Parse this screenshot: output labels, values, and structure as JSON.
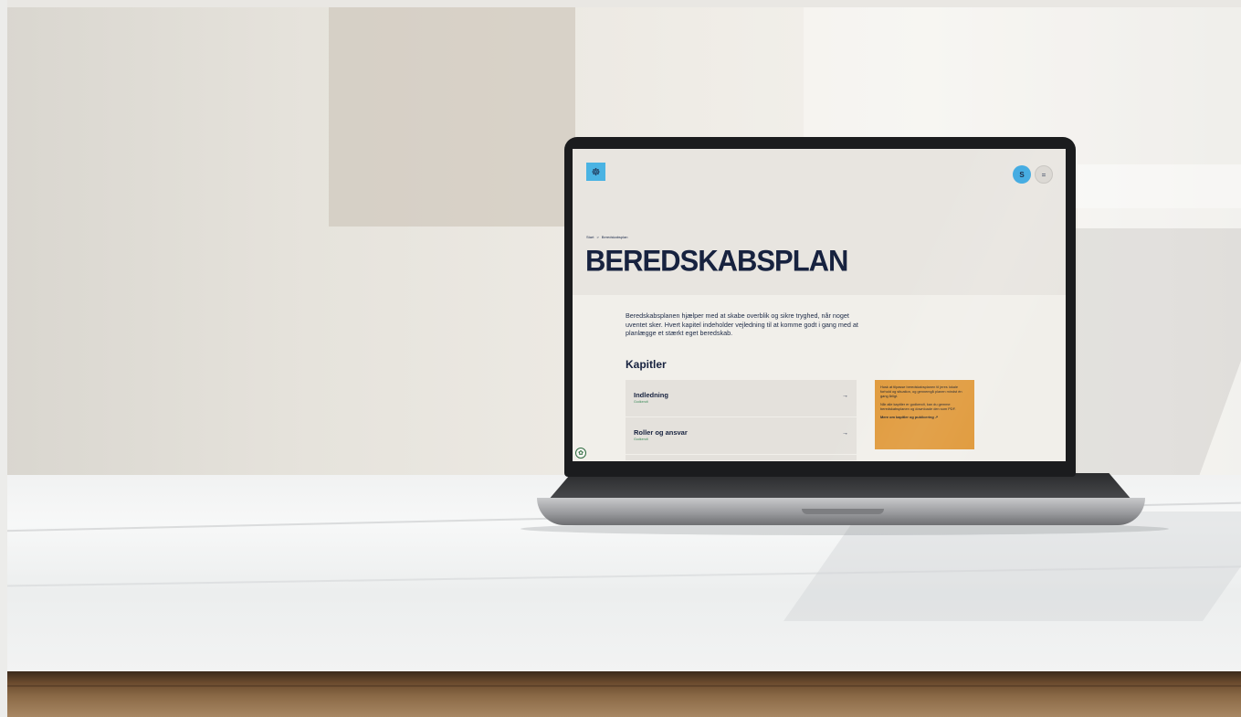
{
  "screen": {
    "logo_icon": "crest-icon",
    "logo_glyph": "☸",
    "user_button_label": "S",
    "menu_button_label": "=",
    "breadcrumb": [
      {
        "label": "Start"
      },
      {
        "label": ">"
      },
      {
        "label": "Beredskabsplan"
      }
    ],
    "page_title": "BEREDSKABSPLAN",
    "intro_text": "Beredskabsplanen hjælper med at skabe overblik og sikre tryghed, når noget uventet sker. Hvert kapitel indeholder vejledning til at komme godt i gang med at planlægge et stærkt eget beredskab.",
    "chapters_heading": "Kapitler",
    "chapters": [
      {
        "title": "Indledning",
        "status": "Godkendt",
        "arrow": "→"
      },
      {
        "title": "Roller og ansvar",
        "status": "Godkendt",
        "arrow": "→"
      }
    ],
    "info_box": {
      "text_1": "Husk at tilpasse beredskabsplanen til jeres lokale forhold og situation, og gennemgå planen mindst én gang årligt.",
      "text_2": "Når alle kapitler er godkendt, kan du gemme beredskabsplanen og downloade den som PDF.",
      "link_label": "Mere om kapitler og publicering ↗"
    },
    "fab_glyph": "✿"
  },
  "colors": {
    "hero_bg": "#e8e5e0",
    "title_navy": "#17223f",
    "logo_blue": "#4ab3e3",
    "info_orange": "#e09a3c",
    "status_green": "#3d8b5a"
  }
}
